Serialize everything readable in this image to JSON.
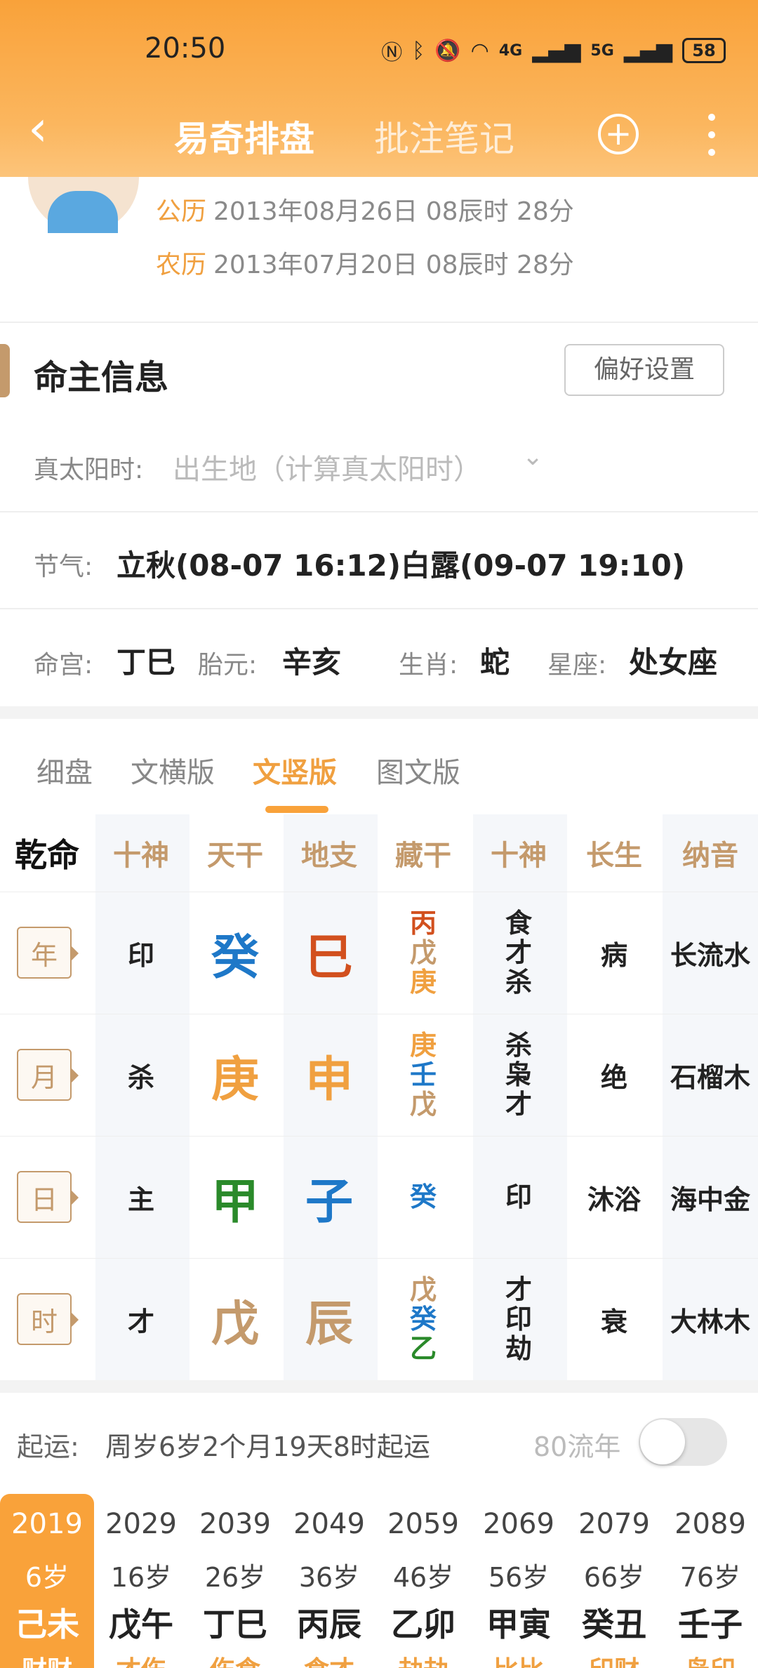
{
  "status_bar": {
    "time": "20:50",
    "battery": "58",
    "signal_4g": "4G",
    "signal_5g": "5G"
  },
  "header": {
    "back_icon": "chevron-left-icon",
    "tab_active": "易奇排盘",
    "tab_inactive": "批注笔记"
  },
  "dates": {
    "solar_label": "公历",
    "solar_value": "2013年08月26日 08辰时 28分",
    "lunar_label": "农历",
    "lunar_value": "2013年07月20日 08辰时 28分"
  },
  "section": {
    "title": "命主信息",
    "pref_button": "偏好设置"
  },
  "info": {
    "solar_time_label": "真太阳时:",
    "solar_time_placeholder": "出生地（计算真太阳时）",
    "jieqi_label": "节气:",
    "jieqi_value": "立秋(08-07 16:12)白露(09-07 19:10)",
    "minggong_label": "命宫:",
    "minggong_value": "丁巳",
    "taiyuan_label": "胎元:",
    "taiyuan_value": "辛亥",
    "shengxiao_label": "生肖:",
    "shengxiao_value": "蛇",
    "xingzuo_label": "星座:",
    "xingzuo_value": "处女座"
  },
  "tabs": [
    "细盘",
    "文横版",
    "文竖版",
    "图文版"
  ],
  "table": {
    "corner": "乾命",
    "headers": [
      "十神",
      "天干",
      "地支",
      "藏干",
      "十神",
      "长生",
      "纳音"
    ],
    "rows": [
      {
        "pillar": "年",
        "shishen": "印",
        "tiangan": "癸",
        "tiangan_color": "#1e78c8",
        "dizhi": "巳",
        "dizhi_color": "#d2501e",
        "canggan": [
          "丙",
          "戊",
          "庚"
        ],
        "canggan_colors": [
          "#d2501e",
          "#c49a6c",
          "#f0a040"
        ],
        "shishen2": [
          "食",
          "才",
          "杀"
        ],
        "changsheng": "病",
        "nayin": "长流水"
      },
      {
        "pillar": "月",
        "shishen": "杀",
        "tiangan": "庚",
        "tiangan_color": "#f0a040",
        "dizhi": "申",
        "dizhi_color": "#f0a040",
        "canggan": [
          "庚",
          "壬",
          "戊"
        ],
        "canggan_colors": [
          "#f0a040",
          "#1e78c8",
          "#c49a6c"
        ],
        "shishen2": [
          "杀",
          "枭",
          "才"
        ],
        "changsheng": "绝",
        "nayin": "石榴木"
      },
      {
        "pillar": "日",
        "shishen": "主",
        "tiangan": "甲",
        "tiangan_color": "#2a8a2a",
        "dizhi": "子",
        "dizhi_color": "#1e78c8",
        "canggan": [
          "癸"
        ],
        "canggan_colors": [
          "#1e78c8"
        ],
        "shishen2": [
          "印"
        ],
        "changsheng": "沐浴",
        "nayin": "海中金"
      },
      {
        "pillar": "时",
        "shishen": "才",
        "tiangan": "戊",
        "tiangan_color": "#c49a6c",
        "dizhi": "辰",
        "dizhi_color": "#c49a6c",
        "canggan": [
          "戊",
          "癸",
          "乙"
        ],
        "canggan_colors": [
          "#c49a6c",
          "#1e78c8",
          "#2a8a2a"
        ],
        "shishen2": [
          "才",
          "印",
          "劫"
        ],
        "changsheng": "衰",
        "nayin": "大林木"
      }
    ]
  },
  "qiyun": {
    "label": "起运:",
    "value": "周岁6岁2个月19天8时起运",
    "liunian_label": "80流年"
  },
  "dayun": [
    {
      "year": "2019",
      "age": "6岁",
      "ganzhi": "己未",
      "shishen": "财财"
    },
    {
      "year": "2029",
      "age": "16岁",
      "ganzhi": "戊午",
      "shishen": "才伤"
    },
    {
      "year": "2039",
      "age": "26岁",
      "ganzhi": "丁巳",
      "shishen": "伤食"
    },
    {
      "year": "2049",
      "age": "36岁",
      "ganzhi": "丙辰",
      "shishen": "食才"
    },
    {
      "year": "2059",
      "age": "46岁",
      "ganzhi": "乙卯",
      "shishen": "劫劫"
    },
    {
      "year": "2069",
      "age": "56岁",
      "ganzhi": "甲寅",
      "shishen": "比比"
    },
    {
      "year": "2079",
      "age": "66岁",
      "ganzhi": "癸丑",
      "shishen": "印财"
    },
    {
      "year": "2089",
      "age": "76岁",
      "ganzhi": "壬子",
      "shishen": "枭印"
    }
  ]
}
